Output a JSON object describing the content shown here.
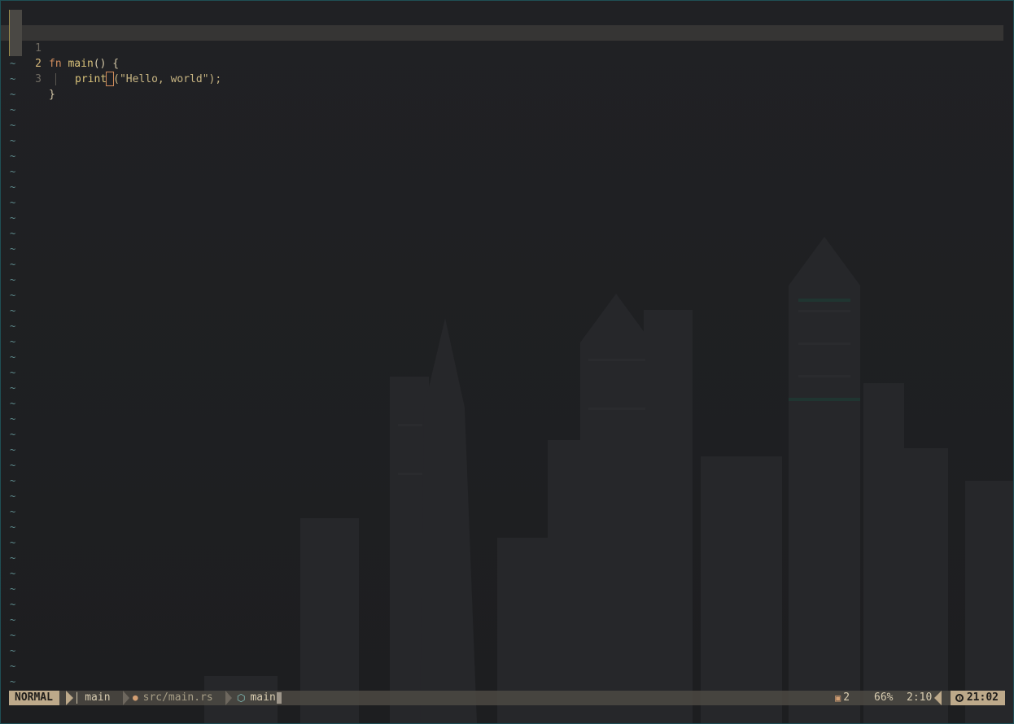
{
  "editor": {
    "lines": [
      {
        "number": "1",
        "tokens": {
          "kw": "fn",
          "fn": "main",
          "punc": "() {"
        }
      },
      {
        "number": "2",
        "tokens": {
          "fn": "print",
          "after_cursor": "(\"Hello, world\");"
        }
      },
      {
        "number": "3",
        "tokens": {
          "punc": "}"
        }
      }
    ],
    "tilde": "~",
    "current_line": 2
  },
  "statusline": {
    "mode": "NORMAL",
    "branch": "main",
    "file_path": "src/main.rs",
    "symbol": "main",
    "package_count": "2",
    "scroll_percent": "66%",
    "position": "2:10",
    "time": "21:02"
  },
  "icons": {
    "branch": "git-branch-icon",
    "file": "rust-file-icon",
    "symbol": "cube-icon",
    "package": "package-icon",
    "clock": "clock-icon"
  },
  "colors": {
    "border": "#1f4f55",
    "mode_bg": "#bda98a",
    "keyword": "#d18d5e",
    "function": "#d9c27a",
    "tilde": "#5d8a8c"
  }
}
